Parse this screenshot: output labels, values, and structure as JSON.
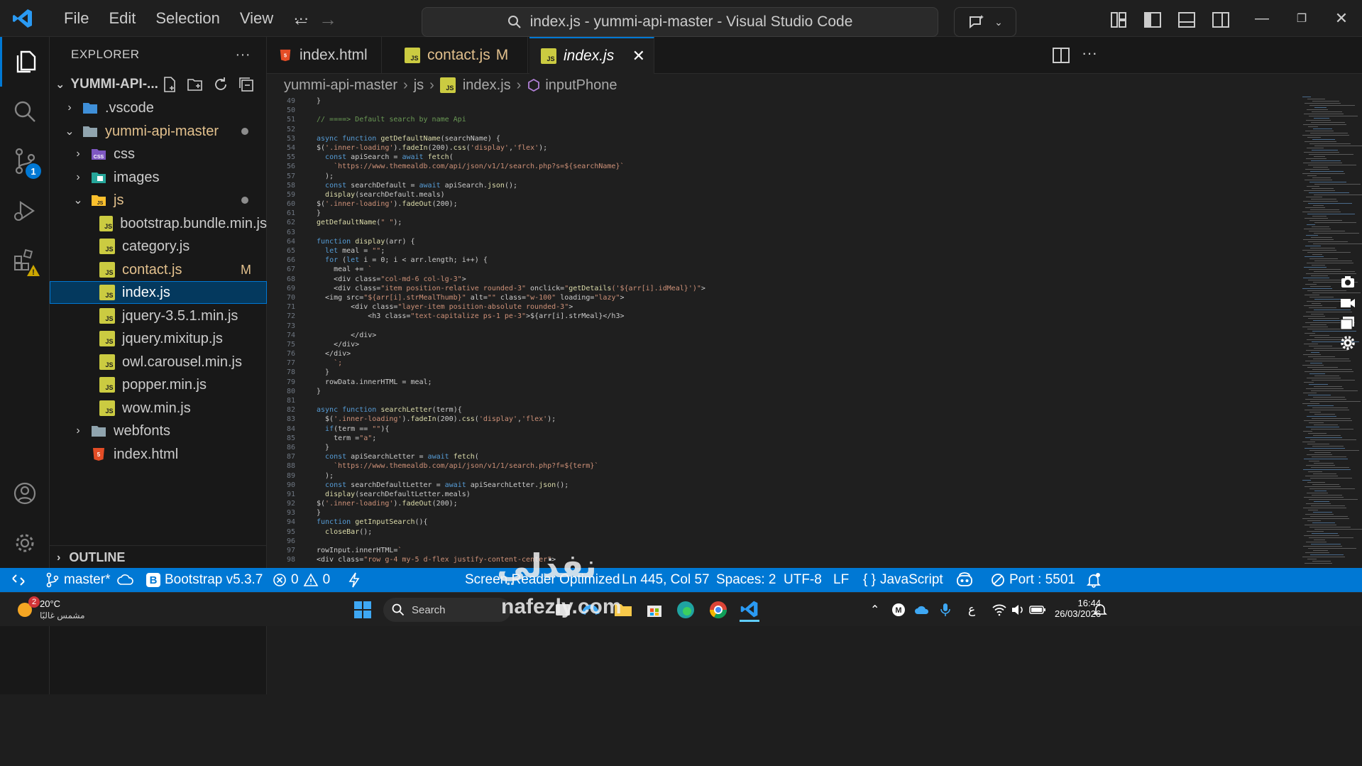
{
  "titlebar": {
    "menu": [
      "File",
      "Edit",
      "Selection",
      "View",
      "···"
    ],
    "command_center": "index.js - yummi-api-master - Visual Studio Code"
  },
  "activity": {
    "scm_badge": "1"
  },
  "sidebar": {
    "title": "EXPLORER",
    "root": "YUMMI-API-...",
    "items": [
      {
        "label": ".vscode"
      },
      {
        "label": "yummi-api-master"
      },
      {
        "label": "css"
      },
      {
        "label": "images"
      },
      {
        "label": "js"
      },
      {
        "label": "bootstrap.bundle.min.js"
      },
      {
        "label": "category.js"
      },
      {
        "label": "contact.js",
        "status": "M"
      },
      {
        "label": "index.js"
      },
      {
        "label": "jquery-3.5.1.min.js"
      },
      {
        "label": "jquery.mixitup.js"
      },
      {
        "label": "owl.carousel.min.js"
      },
      {
        "label": "popper.min.js"
      },
      {
        "label": "wow.min.js"
      },
      {
        "label": "webfonts"
      },
      {
        "label": "index.html"
      }
    ],
    "outline": "OUTLINE"
  },
  "tabs": [
    {
      "label": "index.html"
    },
    {
      "label": "contact.js",
      "status": "M"
    },
    {
      "label": "index.js"
    }
  ],
  "breadcrumb": [
    "yummi-api-master",
    "js",
    "index.js",
    "inputPhone"
  ],
  "editor": {
    "line_numbers": [
      "49",
      "50",
      "51",
      "52",
      "53",
      "54",
      "55",
      "56",
      "57",
      "58",
      "59",
      "60",
      "61",
      "62",
      "63",
      "64",
      "65",
      "66",
      "67",
      "68",
      "69",
      "70",
      "71",
      "72",
      "73",
      "74",
      "75",
      "76",
      "77",
      "78",
      "79",
      "80",
      "81",
      "82",
      "83",
      "84",
      "85",
      "86",
      "87",
      "88",
      "89",
      "90",
      "91",
      "92",
      "93",
      "94",
      "95",
      "96",
      "97",
      "98"
    ],
    "lines": [
      "}",
      "",
      "// ====> Default search by name Api",
      "",
      "async function getDefaultName(searchName) {",
      "$('.inner-loading').fadeIn(200).css('display','flex');",
      "  const apiSearch = await fetch(",
      "    `https://www.themealdb.com/api/json/v1/1/search.php?s=${searchName}`",
      "  );",
      "  const searchDefault = await apiSearch.json();",
      "  display(searchDefault.meals)",
      "$('.inner-loading').fadeOut(200);",
      "}",
      "getDefaultName(\" \");",
      "",
      "function display(arr) {",
      "  let meal = \"\";",
      "  for (let i = 0; i < arr.length; i++) {",
      "    meal += `",
      "    <div class=\"col-md-6 col-lg-3\">",
      "    <div class=\"item position-relative rounded-3\" onclick=\"getDetails('${arr[i].idMeal}')\">",
      "  <img src=\"${arr[i].strMealThumb}\" alt=\"\" class=\"w-100\" loading=\"lazy\">",
      "        <div class=\"layer-item position-absolute rounded-3\">",
      "            <h3 class=\"text-capitalize ps-1 pe-3\">${arr[i].strMeal}</h3>",
      "",
      "        </div>",
      "    </div>",
      "  </div>",
      "    `;",
      "  }",
      "  rowData.innerHTML = meal;",
      "}",
      "",
      "async function searchLetter(term){",
      "  $('.inner-loading').fadeIn(200).css('display','flex');",
      "  if(term == \"\"){",
      "    term =\"a\";",
      "  }",
      "  const apiSearchLetter = await fetch(",
      "    `https://www.themealdb.com/api/json/v1/1/search.php?f=${term}`",
      "  );",
      "  const searchDefaultLetter = await apiSearchLetter.json();",
      "  display(searchDefaultLetter.meals)",
      "$('.inner-loading').fadeOut(200);",
      "}",
      "function getInputSearch(){",
      "  closeBar();",
      "",
      "rowInput.innerHTML=`",
      "<div class=\"row g-4 my-5 d-flex justify-content-center\">"
    ]
  },
  "statusbar": {
    "branch": "master*",
    "bootstrap": "Bootstrap v5.3.7",
    "errors": "0",
    "warnings": "0",
    "screen_reader": "Screen Reader Optimized",
    "position": "Ln 445, Col 57",
    "spaces": "Spaces: 2",
    "encoding": "UTF-8",
    "eol": "LF",
    "language": "JavaScript",
    "port": "Port : 5501"
  },
  "taskbar": {
    "weather_temp": "20°C",
    "weather_desc": "مشمس غالبًا",
    "weather_badge": "2",
    "search": "Search",
    "lang": "ع",
    "time": "16:44",
    "date": "26/03/2026"
  },
  "watermark": {
    "arabic": "نفذلي",
    "latin": "nafezly.com"
  },
  "colors": {
    "accent": "#0078d4",
    "keyword": "#569cd6",
    "string": "#ce9178",
    "function": "#dcdcaa",
    "variable": "#9cdcfe",
    "comment": "#6a9955",
    "modified": "#e2c08d",
    "js_icon": "#cbcb41"
  }
}
